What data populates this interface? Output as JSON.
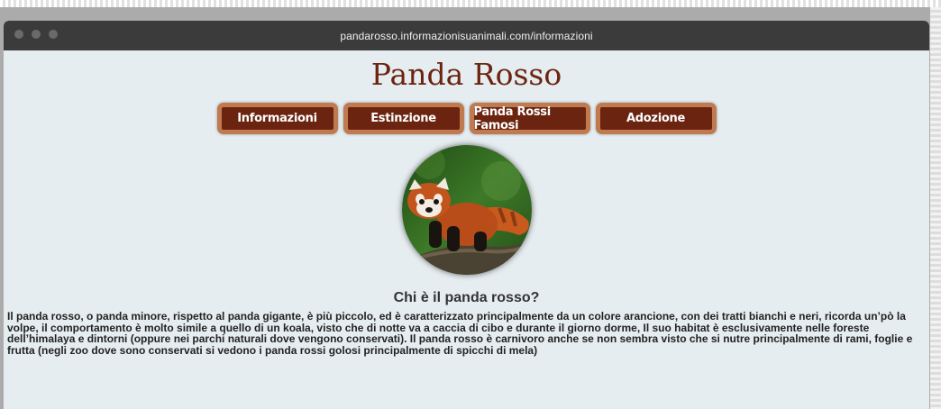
{
  "browser": {
    "url": "pandarosso.informazionisuanimali.com/informazioni"
  },
  "page": {
    "title": "Panda Rosso",
    "nav": [
      {
        "label": "Informazioni"
      },
      {
        "label": "Estinzione"
      },
      {
        "label": "Panda Rossi Famosi"
      },
      {
        "label": "Adozione"
      }
    ],
    "section_heading": "Chi è il panda rosso?",
    "paragraph": "Il panda rosso, o panda minore, rispetto al panda gigante, è più piccolo, ed è caratterizzato principalmente da un colore arancione, con dei tratti bianchi e neri, ricorda un’pò la volpe, il comportamento è molto simile a quello di un koala, visto che di notte va a caccia di cibo e durante il giorno dorme,  Il suo habitat è esclusivamente nelle foreste dell’himalaya e dintorni (oppure nei parchi naturali dove vengono conservati). Il panda rosso è carnivoro anche se non sembra visto che si nutre principalmente di rami, foglie e frutta (negli zoo dove sono conservati si vedono i panda rossi golosi principalmente di spicchi di mela)"
  },
  "colors": {
    "title": "#6b2410",
    "nav_bg": "#6b2410",
    "nav_border": "#c07a50",
    "page_bg": "#e6edf0",
    "titlebar": "#3b3b3b"
  }
}
